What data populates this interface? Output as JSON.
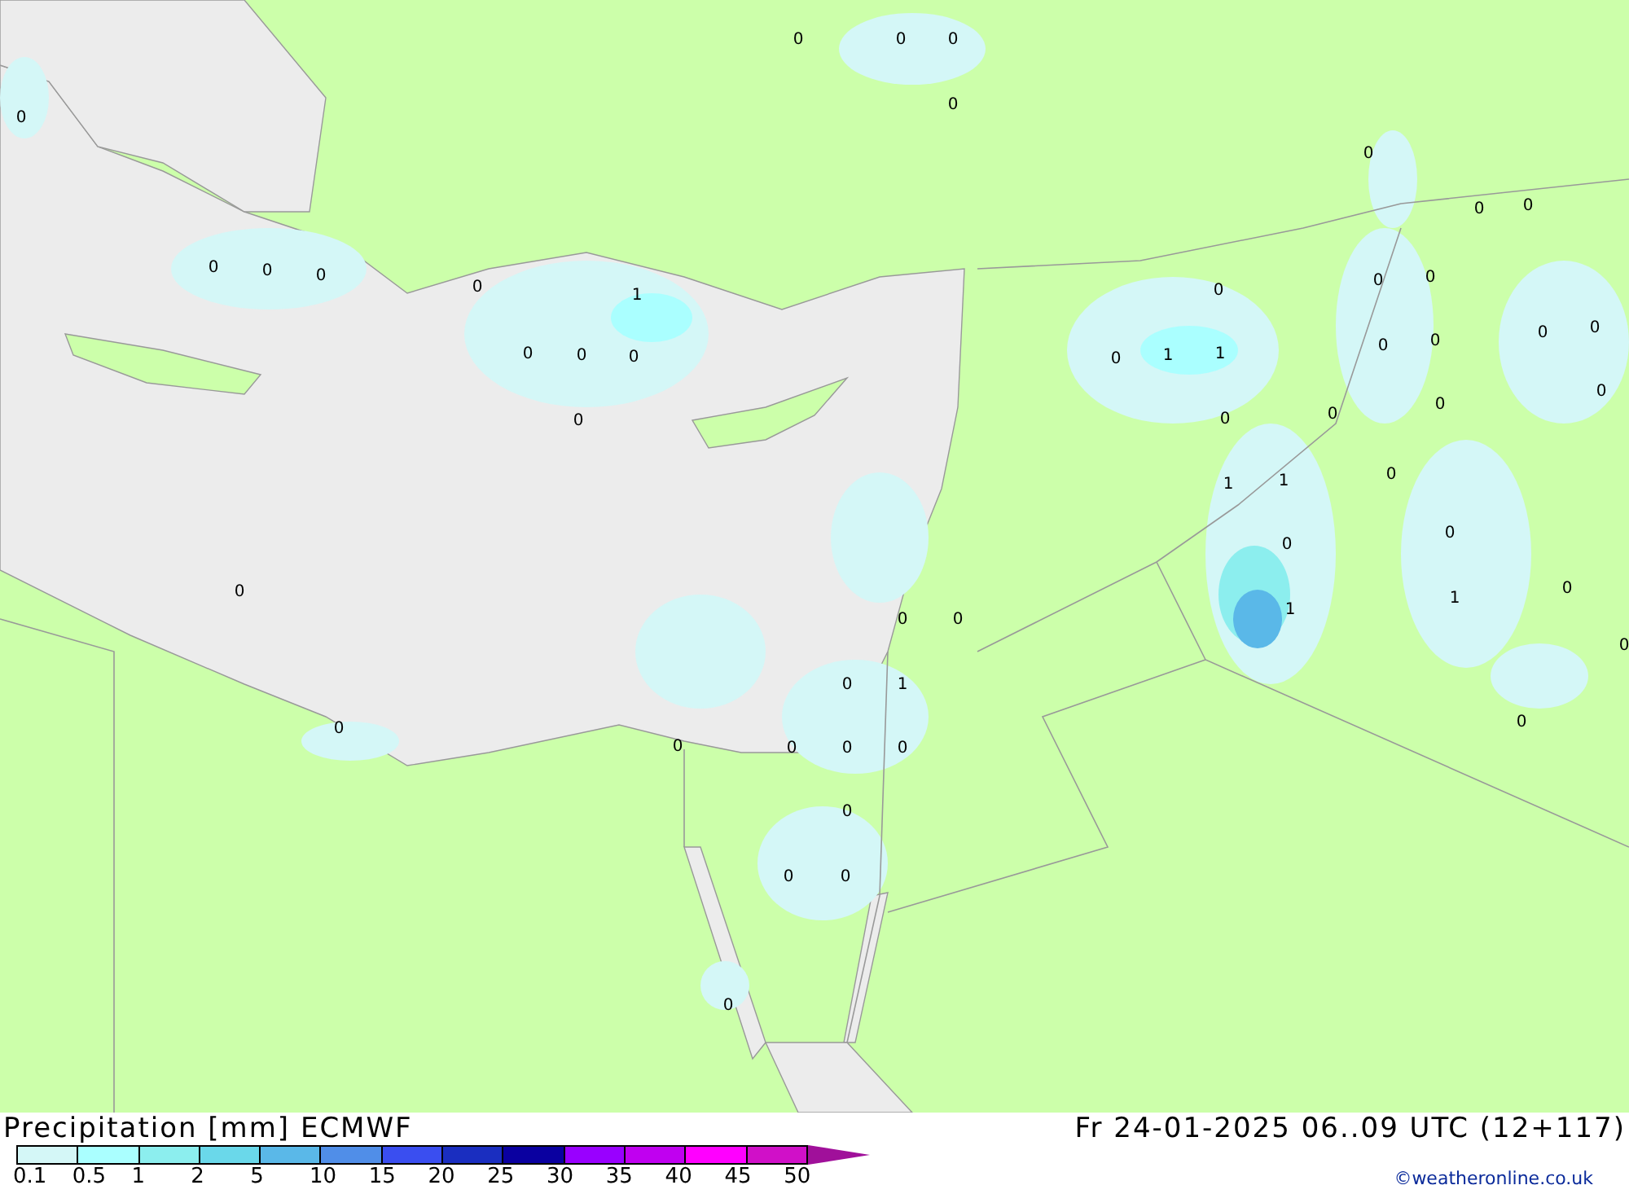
{
  "map": {
    "labels": [
      "0",
      "0",
      "0",
      "0",
      "0",
      "0",
      "0",
      "0",
      "0",
      "0",
      "0",
      "0",
      "1",
      "0",
      "0",
      "0",
      "0",
      "0",
      "0",
      "0",
      "1",
      "1",
      "0",
      "0",
      "0",
      "0",
      "0",
      "0",
      "0",
      "0",
      "0",
      "1",
      "1",
      "0",
      "0",
      "0",
      "0",
      "0",
      "0",
      "1",
      "1",
      "0",
      "0",
      "0",
      "1",
      "0",
      "0",
      "0",
      "0",
      "0",
      "0",
      "0",
      "0",
      "0",
      "0"
    ]
  },
  "legend": {
    "title": "Precipitation [mm] ECMWF",
    "swatches": [
      {
        "kind": "box",
        "color": "#d4f7f7"
      },
      {
        "kind": "box",
        "color": "#aaffff"
      },
      {
        "kind": "box",
        "color": "#8ceeee"
      },
      {
        "kind": "box",
        "color": "#6ad8ea"
      },
      {
        "kind": "box",
        "color": "#5ab8e8"
      },
      {
        "kind": "box",
        "color": "#508ee8"
      },
      {
        "kind": "box",
        "color": "#3a4ef0"
      },
      {
        "kind": "box",
        "color": "#1a2ec0"
      },
      {
        "kind": "box",
        "color": "#0a00a0"
      },
      {
        "kind": "box",
        "color": "#9900ff"
      },
      {
        "kind": "box",
        "color": "#c000f0"
      },
      {
        "kind": "box",
        "color": "#ff00ff"
      },
      {
        "kind": "box",
        "color": "#d010c8"
      },
      {
        "kind": "arrow",
        "color": "#a0109a"
      }
    ],
    "ticks": [
      "0.1",
      "0.5",
      "1",
      "2",
      "5",
      "10",
      "15",
      "20",
      "25",
      "30",
      "35",
      "40",
      "45",
      "50"
    ]
  },
  "valid_time": "Fr 24-01-2025 06..09 UTC (12+117)",
  "credit": "©weatheronline.co.uk"
}
